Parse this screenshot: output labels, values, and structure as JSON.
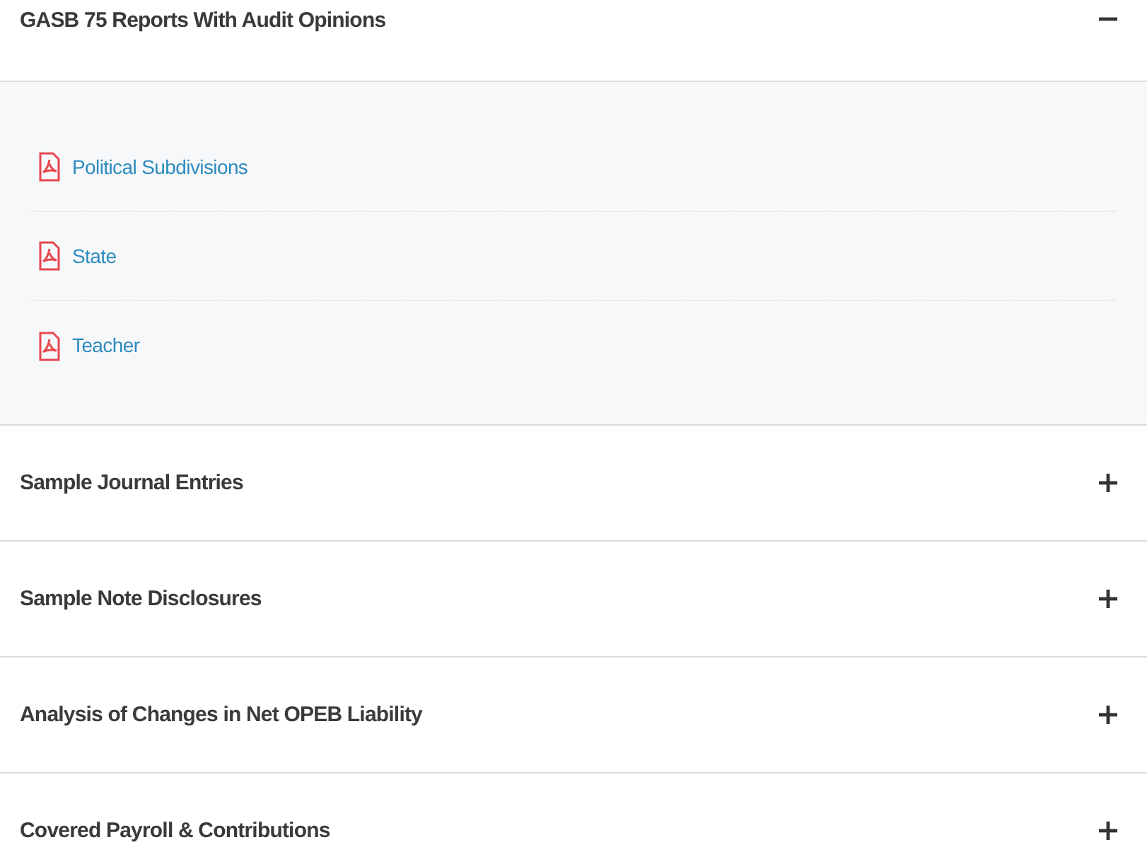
{
  "sections": [
    {
      "title": "GASB 75 Reports With Audit Opinions",
      "expanded": true,
      "links": [
        {
          "label": "Political Subdivisions"
        },
        {
          "label": "State"
        },
        {
          "label": "Teacher"
        }
      ]
    },
    {
      "title": "Sample Journal Entries",
      "expanded": false
    },
    {
      "title": "Sample Note Disclosures",
      "expanded": false
    },
    {
      "title": "Analysis of Changes in Net OPEB Liability",
      "expanded": false
    },
    {
      "title": "Covered Payroll & Contributions",
      "expanded": false
    }
  ]
}
